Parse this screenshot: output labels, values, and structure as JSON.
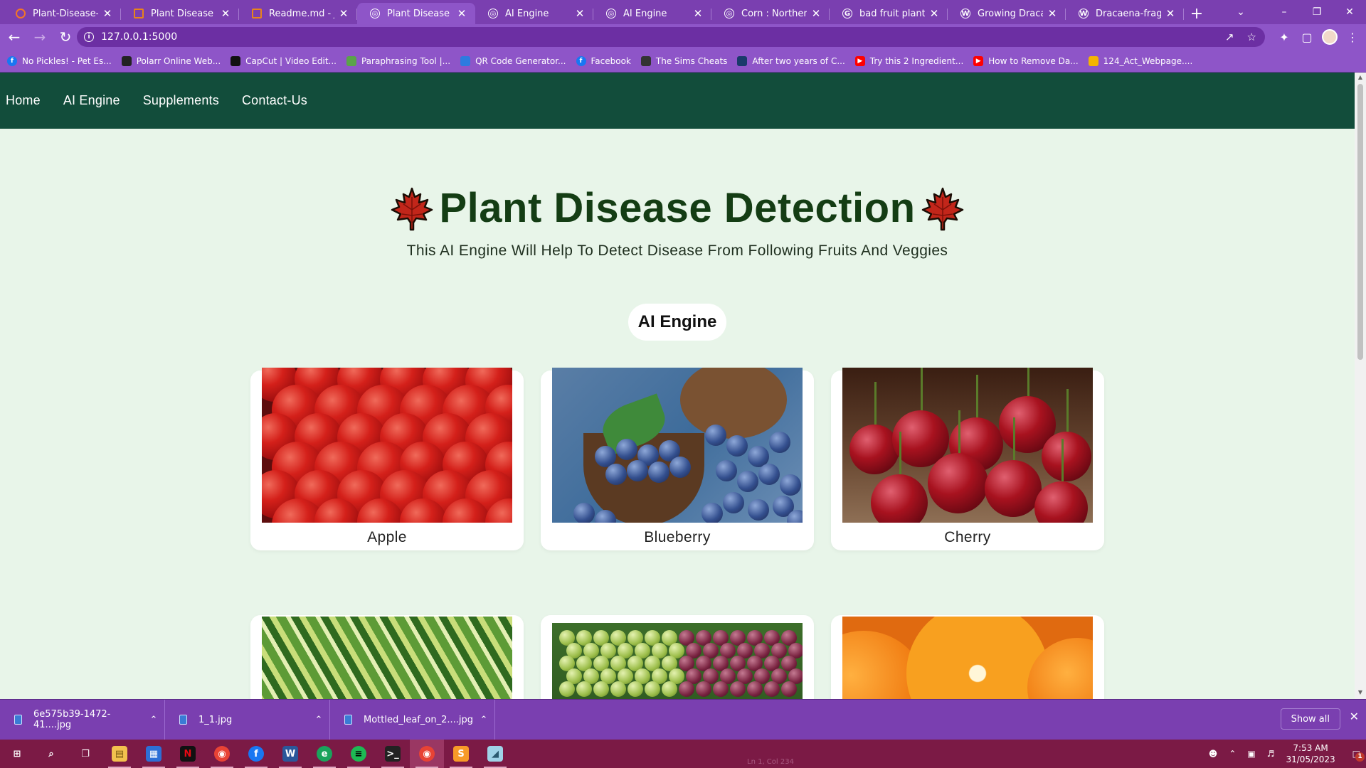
{
  "browser": {
    "tabs": [
      {
        "title": "Plant-Disease-Dete",
        "icon": "jupyter-icon",
        "color": "#f37626"
      },
      {
        "title": "Plant Disease Dete",
        "icon": "notebook-icon",
        "color": "#e8841a"
      },
      {
        "title": "Readme.md - Jupy",
        "icon": "file-icon",
        "color": "#e8841a"
      },
      {
        "title": "Plant Disease Dete",
        "icon": "globe-icon",
        "color": "#ffffff",
        "active": true
      },
      {
        "title": "AI Engine",
        "icon": "globe-icon",
        "color": "#ffffff"
      },
      {
        "title": "AI Engine",
        "icon": "globe-icon",
        "color": "#ffffff"
      },
      {
        "title": "Corn : Northern Le",
        "icon": "globe-icon",
        "color": "#ffffff"
      },
      {
        "title": "bad fruit plant leav",
        "icon": "google-icon",
        "color": "#ffffff"
      },
      {
        "title": "Growing Dracaena",
        "icon": "wordpress-icon",
        "color": "#ffffff"
      },
      {
        "title": "Dracaena-fragrans",
        "icon": "wordpress-icon",
        "color": "#ffffff"
      }
    ],
    "url": "127.0.0.1:5000",
    "bookmarks": [
      {
        "label": "No Pickles! - Pet Es...",
        "icon": "facebook-icon",
        "color": "#1877f2"
      },
      {
        "label": "Polarr Online Web...",
        "icon": "polarr-icon",
        "color": "#222222"
      },
      {
        "label": "CapCut | Video Edit...",
        "icon": "capcut-icon",
        "color": "#111111"
      },
      {
        "label": "Paraphrasing Tool |...",
        "icon": "quillbot-icon",
        "color": "#5aa34a"
      },
      {
        "label": "QR Code Generator...",
        "icon": "qr-icon",
        "color": "#2d7be0"
      },
      {
        "label": "Facebook",
        "icon": "facebook-icon",
        "color": "#1877f2"
      },
      {
        "label": "The Sims Cheats",
        "icon": "sims-icon",
        "color": "#333333"
      },
      {
        "label": "After two years of C...",
        "icon": "bookmark-icon",
        "color": "#1a3a6b"
      },
      {
        "label": "Try this 2 Ingredient...",
        "icon": "youtube-icon",
        "color": "#ff0000"
      },
      {
        "label": "How to Remove Da...",
        "icon": "youtube-icon",
        "color": "#ff0000"
      },
      {
        "label": "124_Act_Webpage....",
        "icon": "drive-icon",
        "color": "#f4b400"
      }
    ]
  },
  "site": {
    "nav": [
      "Home",
      "AI Engine",
      "Supplements",
      "Contact-Us"
    ],
    "title": "Plant Disease Detection",
    "subtitle": "This AI Engine Will Help To Detect Disease From Following Fruits And Veggies",
    "section": "AI Engine",
    "cards": [
      {
        "label": "Apple",
        "image": "apple"
      },
      {
        "label": "Blueberry",
        "image": "blueberry"
      },
      {
        "label": "Cherry",
        "image": "cherry"
      },
      {
        "label": "",
        "image": "dracaena"
      },
      {
        "label": "",
        "image": "grape"
      },
      {
        "label": "",
        "image": "orange"
      }
    ],
    "colors": {
      "nav_bg": "#124d3b",
      "page_bg": "#e8f5e9",
      "title": "#143d14"
    }
  },
  "downloads": {
    "items": [
      "6e575b39-1472-41....jpg",
      "1_1.jpg",
      "Mottled_leaf_on_2....jpg"
    ],
    "show_all": "Show all"
  },
  "taskbar": {
    "apps": [
      "start-icon",
      "search-icon",
      "task-view-icon",
      "file-explorer-icon",
      "store-icon",
      "netflix-icon",
      "chrome-icon",
      "facebook-icon",
      "word-icon",
      "edge-icon",
      "spotify-icon",
      "terminal-icon",
      "chrome-profile-icon",
      "sublime-icon",
      "notes-icon"
    ],
    "time": "7:53 AM",
    "date": "31/05/2023",
    "status_text": "Ln 1, Col 234",
    "notifications": "1"
  }
}
